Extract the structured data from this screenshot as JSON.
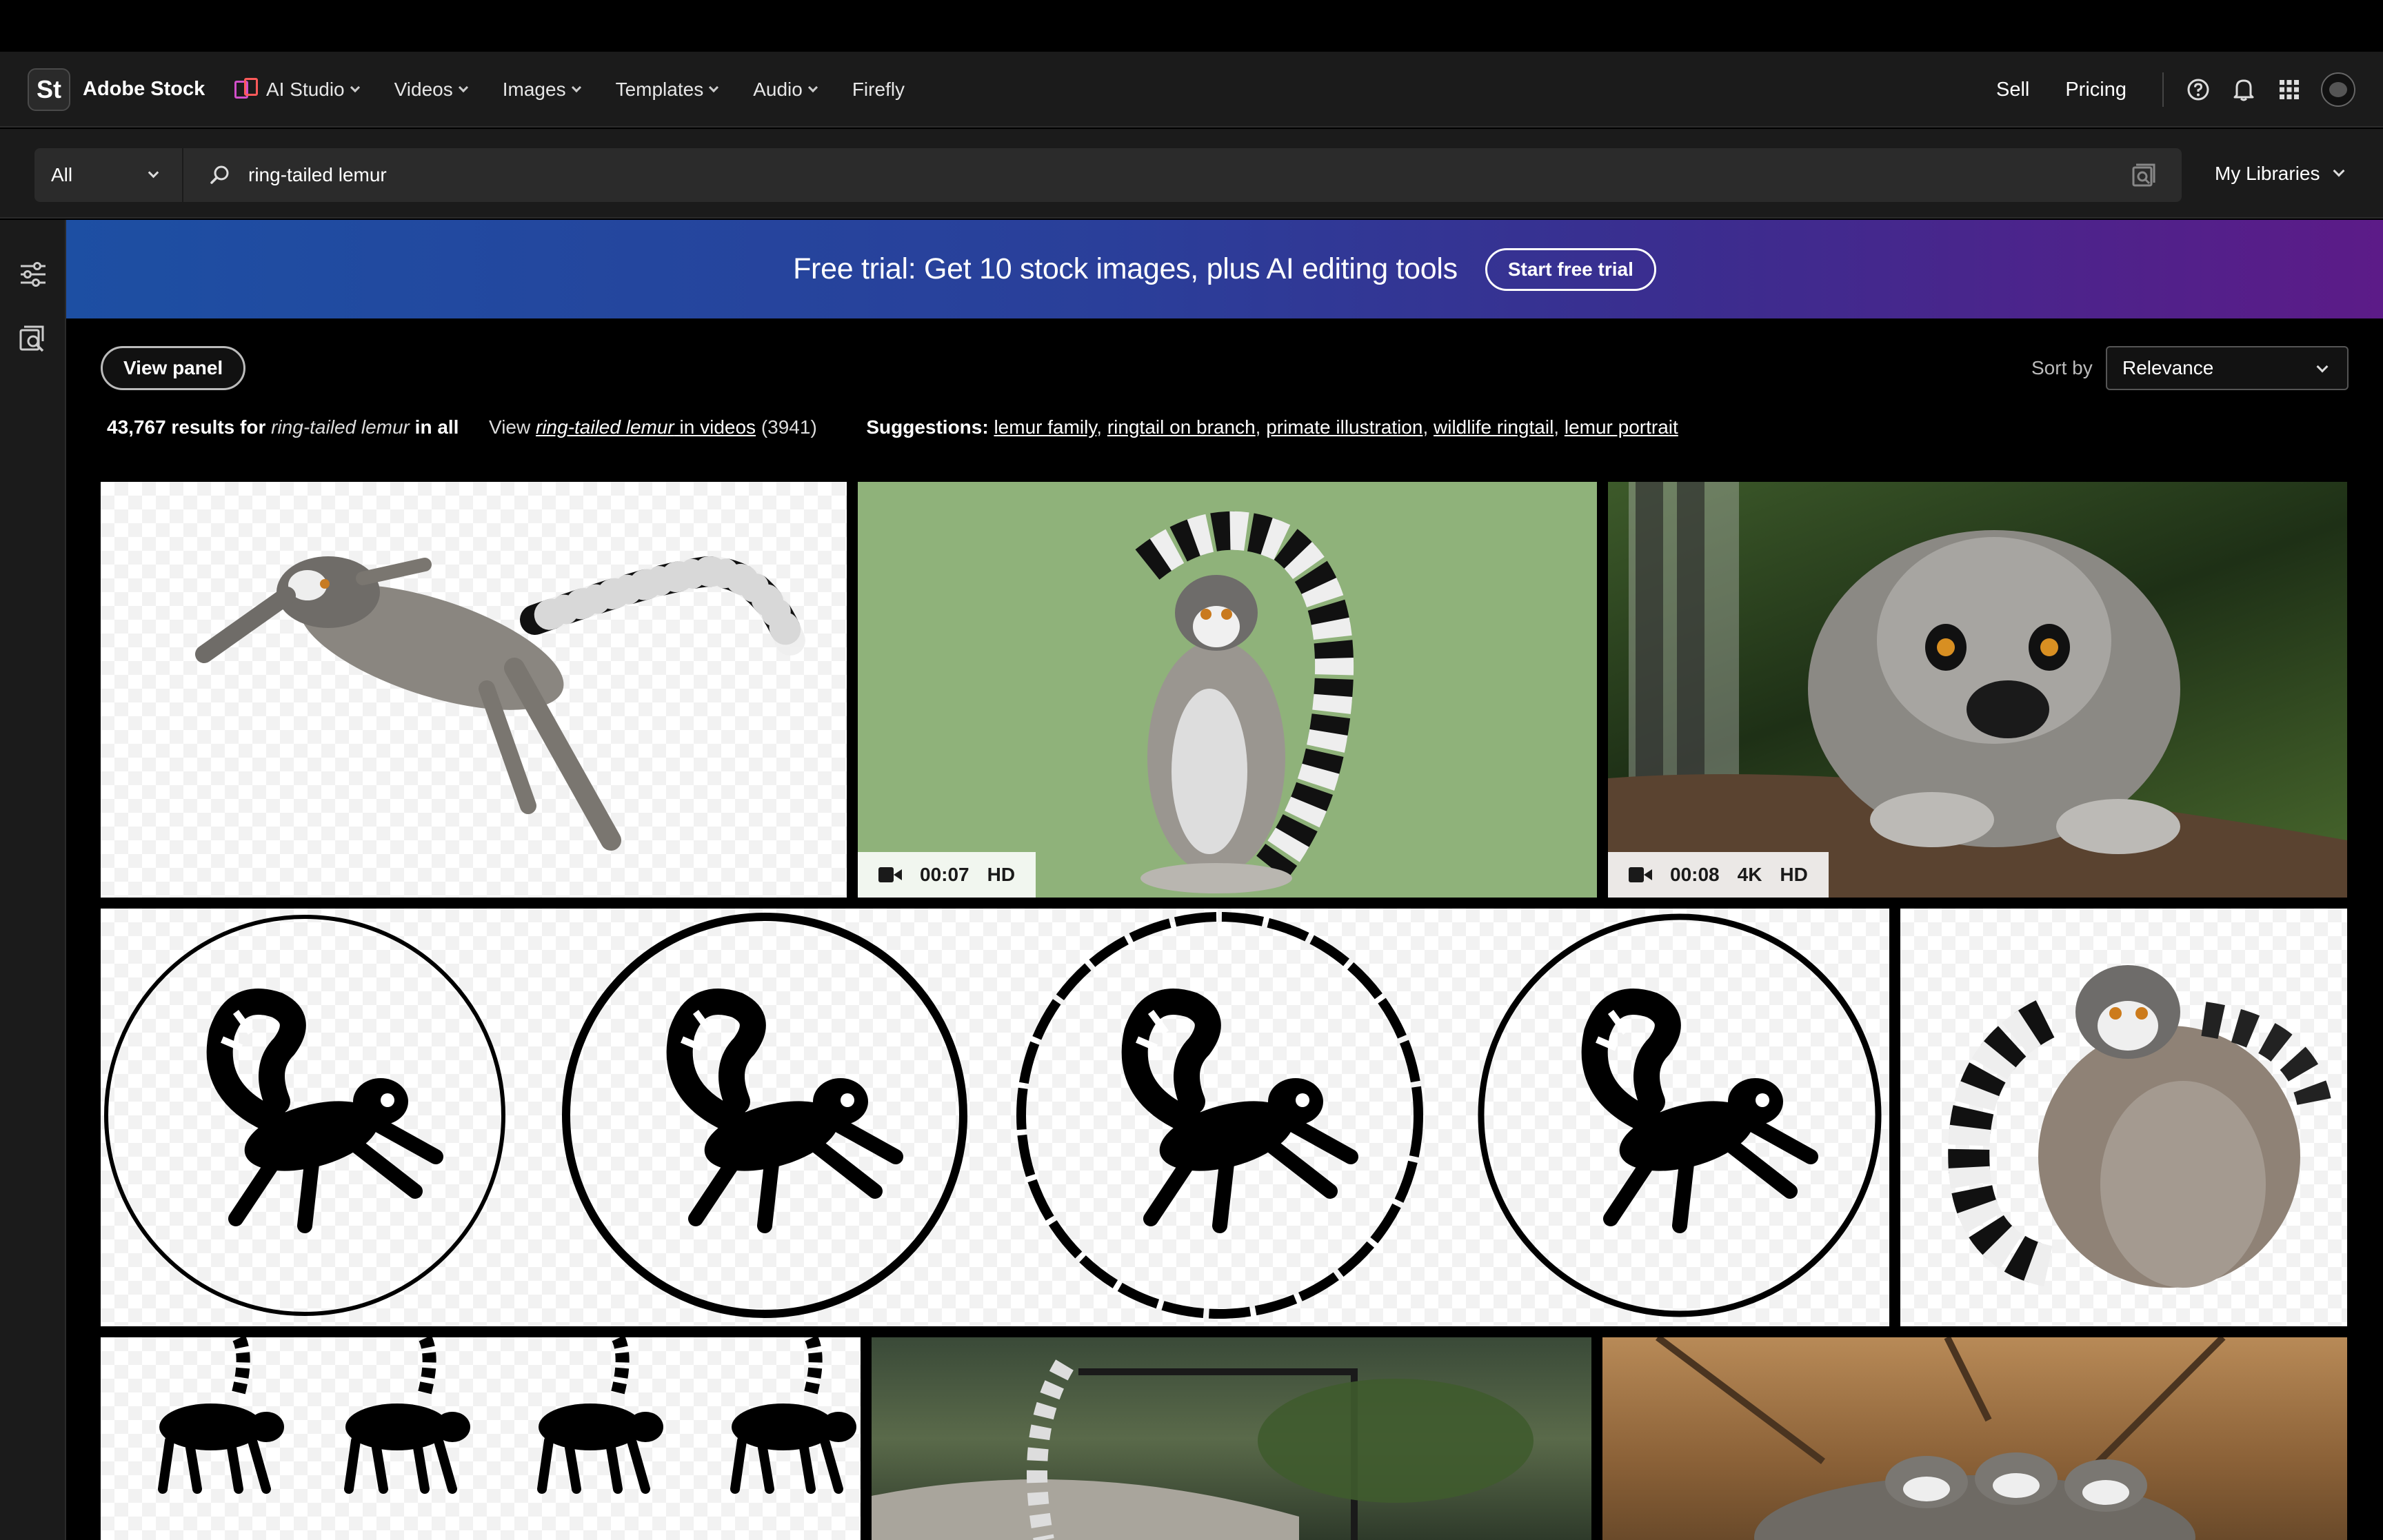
{
  "header": {
    "logo_text": "St",
    "brand": "Adobe Stock",
    "nav": [
      {
        "label": "AI Studio",
        "has_menu": true
      },
      {
        "label": "Videos",
        "has_menu": true
      },
      {
        "label": "Images",
        "has_menu": true
      },
      {
        "label": "Templates",
        "has_menu": true
      },
      {
        "label": "Audio",
        "has_menu": true
      },
      {
        "label": "Firefly",
        "has_menu": false
      }
    ],
    "sell": "Sell",
    "pricing": "Pricing",
    "icons": [
      "help-icon",
      "bell-icon",
      "apps-grid-icon",
      "avatar"
    ]
  },
  "search": {
    "scope": "All",
    "query": "ring-tailed lemur",
    "my_libraries": "My Libraries"
  },
  "banner": {
    "text": "Free trial: Get 10 stock images, plus AI editing tools",
    "button": "Start free trial"
  },
  "toolbar": {
    "view_panel": "View panel",
    "sort_label": "Sort by",
    "sort_value": "Relevance"
  },
  "results": {
    "count": "43,767",
    "results_for": "results for",
    "query": "ring-tailed lemur",
    "in_all": "in all",
    "view": "View",
    "in_videos": "in videos",
    "video_count": "(3941)",
    "suggestions_label": "Suggestions:",
    "suggestions": [
      "lemur family",
      "ringtail on branch",
      "primate illustration",
      "wildlife ringtail",
      "lemur portrait"
    ]
  },
  "tiles": [
    {
      "id": "leaping-lemur-cutout",
      "kind": "image"
    },
    {
      "id": "sitting-lemur-green",
      "kind": "video",
      "duration": "00:07",
      "quality": [
        "HD"
      ]
    },
    {
      "id": "lemur-on-branch-closeup",
      "kind": "video",
      "duration": "00:08",
      "quality": [
        "4K",
        "HD"
      ]
    },
    {
      "id": "lemur-logo-set",
      "kind": "image"
    },
    {
      "id": "lemur-sitting-cutout",
      "kind": "image"
    },
    {
      "id": "lemur-silhouette-set",
      "kind": "image"
    },
    {
      "id": "lemur-in-zoo-garden",
      "kind": "image"
    },
    {
      "id": "lemur-group-tree",
      "kind": "image"
    }
  ],
  "colors": {
    "header_bg": "#1b1b1b",
    "banner_start": "#1d4fa3",
    "banner_end": "#5c1b88",
    "green_bg": "#8fb27a"
  }
}
